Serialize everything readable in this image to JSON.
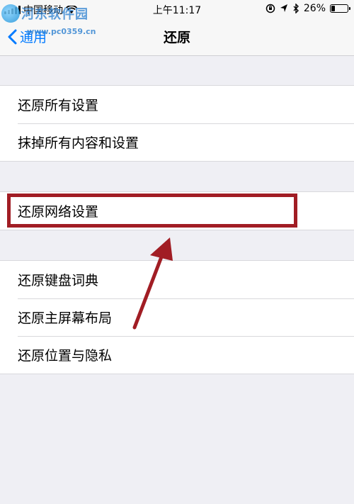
{
  "status_bar": {
    "carrier": "中国移动",
    "time": "上午11:17",
    "battery_percent_label": "26%",
    "battery_level": 0.26
  },
  "watermark": {
    "title": "河东软件园",
    "url": "www.pc0359.cn"
  },
  "nav": {
    "back_label": "通用",
    "title": "还原"
  },
  "groups": [
    {
      "items": [
        "还原所有设置",
        "抹掉所有内容和设置"
      ]
    },
    {
      "items": [
        "还原网络设置"
      ]
    },
    {
      "items": [
        "还原键盘词典",
        "还原主屏幕布局",
        "还原位置与隐私"
      ]
    }
  ],
  "colors": {
    "accent": "#007aff",
    "highlight": "#a11d24",
    "background": "#efeff4"
  }
}
